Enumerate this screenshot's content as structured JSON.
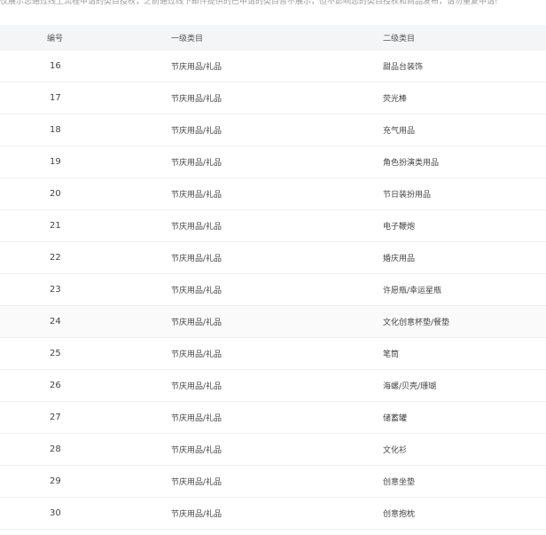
{
  "notice": "仅展示您通过线上流程申请的类目授权，之前通过线下邮件提供的已申请的类目暂不展示，但不影响您的类目授权和商品发布，请勿重复申请!",
  "table": {
    "headers": [
      "编号",
      "一级类目",
      "二级类目"
    ],
    "rows": [
      {
        "id": "16",
        "l1": "节庆用品/礼品",
        "l2": "甜品台装饰"
      },
      {
        "id": "17",
        "l1": "节庆用品/礼品",
        "l2": "荧光棒"
      },
      {
        "id": "18",
        "l1": "节庆用品/礼品",
        "l2": "充气用品"
      },
      {
        "id": "19",
        "l1": "节庆用品/礼品",
        "l2": "角色扮演类用品"
      },
      {
        "id": "20",
        "l1": "节庆用品/礼品",
        "l2": "节日装扮用品"
      },
      {
        "id": "21",
        "l1": "节庆用品/礼品",
        "l2": "电子鞭炮"
      },
      {
        "id": "22",
        "l1": "节庆用品/礼品",
        "l2": "婚庆用品"
      },
      {
        "id": "23",
        "l1": "节庆用品/礼品",
        "l2": "许愿瓶/幸运星瓶"
      },
      {
        "id": "24",
        "l1": "节庆用品/礼品",
        "l2": "文化创意杯垫/餐垫"
      },
      {
        "id": "25",
        "l1": "节庆用品/礼品",
        "l2": "笔筒"
      },
      {
        "id": "26",
        "l1": "节庆用品/礼品",
        "l2": "海螺/贝壳/珊瑚"
      },
      {
        "id": "27",
        "l1": "节庆用品/礼品",
        "l2": "储蓄罐"
      },
      {
        "id": "28",
        "l1": "节庆用品/礼品",
        "l2": "文化衫"
      },
      {
        "id": "29",
        "l1": "节庆用品/礼品",
        "l2": "创意坐垫"
      },
      {
        "id": "30",
        "l1": "节庆用品/礼品",
        "l2": "创意抱枕"
      }
    ]
  }
}
